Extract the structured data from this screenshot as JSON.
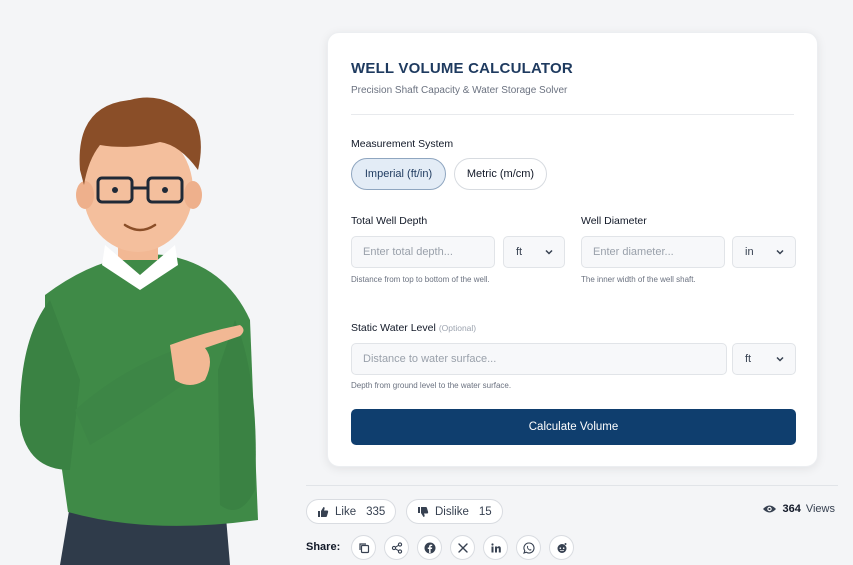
{
  "calculator": {
    "title": "WELL VOLUME CALCULATOR",
    "subtitle": "Precision Shaft Capacity & Water Storage Solver",
    "measurement_label": "Measurement System",
    "systems": [
      {
        "label": "Imperial (ft/in)",
        "active": true
      },
      {
        "label": "Metric (m/cm)",
        "active": false
      }
    ],
    "depth": {
      "label": "Total Well Depth",
      "placeholder": "Enter total depth...",
      "unit": "ft",
      "hint": "Distance from top to bottom of the well."
    },
    "diameter": {
      "label": "Well Diameter",
      "placeholder": "Enter diameter...",
      "unit": "in",
      "hint": "The inner width of the well shaft."
    },
    "water_level": {
      "label": "Static Water Level",
      "optional": "(Optional)",
      "placeholder": "Distance to water surface...",
      "unit": "ft",
      "hint": "Depth from ground level to the water surface."
    },
    "calculate_label": "Calculate Volume"
  },
  "engagement": {
    "like_label": "Like",
    "like_count": "335",
    "dislike_label": "Dislike",
    "dislike_count": "15",
    "views_count": "364",
    "views_label": "Views",
    "share_label": "Share:"
  },
  "icons": {
    "share": [
      "copy-icon",
      "share-icon",
      "facebook-icon",
      "x-icon",
      "linkedin-icon",
      "whatsapp-icon",
      "reddit-icon"
    ]
  },
  "colors": {
    "primary": "#0f3e6e",
    "title": "#1e3a5f",
    "active_pill_bg": "#e3ecf6",
    "sweater": "#3f8a47"
  }
}
